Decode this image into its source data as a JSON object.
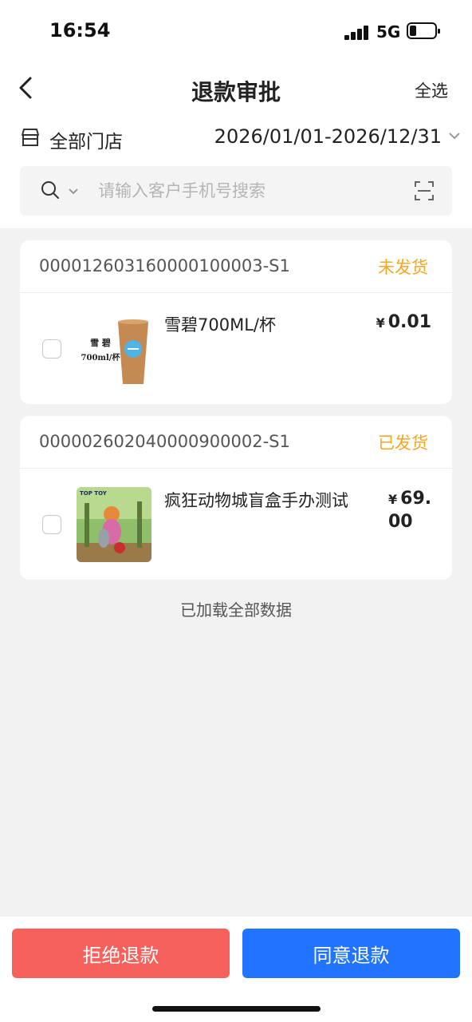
{
  "status": {
    "time": "16:54",
    "network": "5G"
  },
  "nav": {
    "title": "退款审批",
    "select_all": "全选"
  },
  "filter": {
    "store": "全部门店",
    "date_range": "2026/01/01-2026/12/31"
  },
  "search": {
    "placeholder": "请输入客户手机号搜索",
    "value": ""
  },
  "orders": [
    {
      "order_no": "000012603160000100003-S1",
      "status": "未发货",
      "product": {
        "name": "雪碧700ML/杯",
        "currency": "¥",
        "price": "0.01",
        "image_text": [
          "雪 碧",
          "700ml/杯"
        ]
      }
    },
    {
      "order_no": "000002602040000900002-S1",
      "status": "已发货",
      "product": {
        "name": "疯狂动物城盲盒手办测试",
        "currency": "¥",
        "price_line1": "69.",
        "price_line2": "00",
        "image_text": [
          "TOP TOY"
        ]
      }
    }
  ],
  "footer_note": "已加载全部数据",
  "actions": {
    "reject": "拒绝退款",
    "approve": "同意退款"
  },
  "colors": {
    "accent_orange": "#f5a623",
    "reject_red": "#f7615c",
    "approve_blue": "#2174ff"
  }
}
